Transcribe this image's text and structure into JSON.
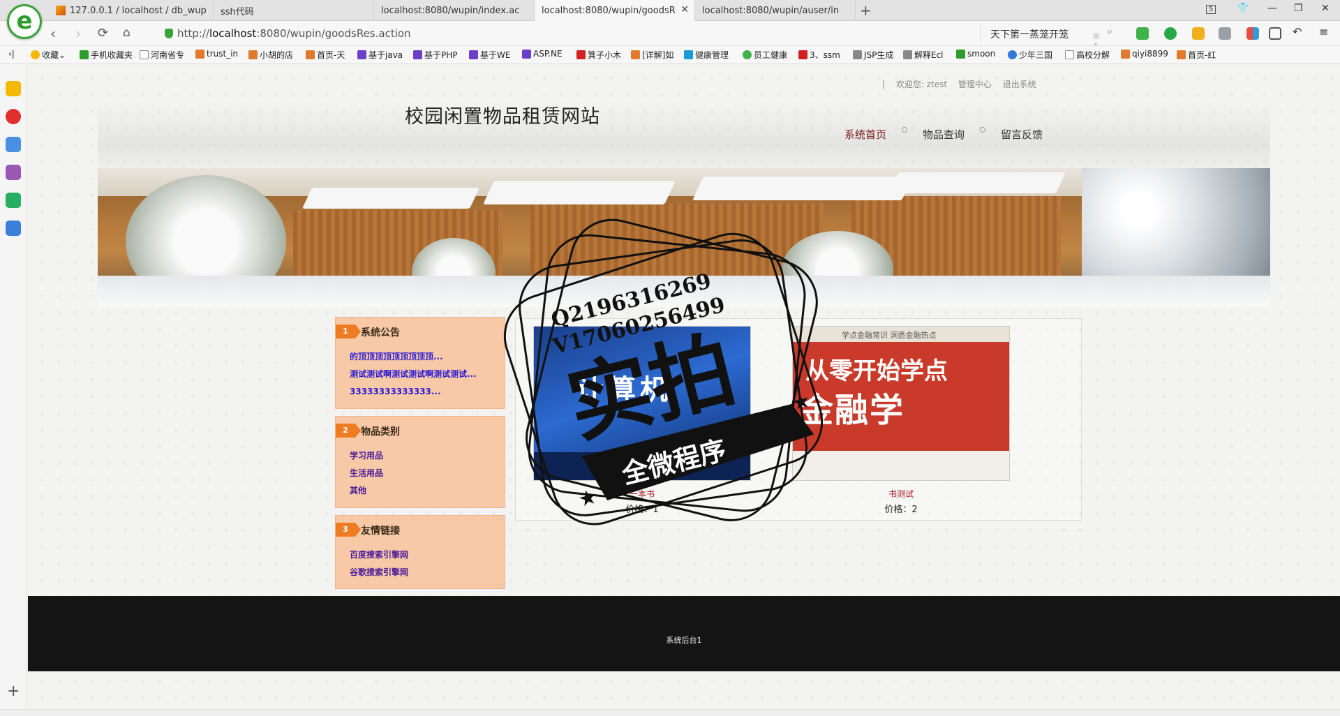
{
  "browser": {
    "tabs": [
      {
        "label": "127.0.0.1 / localhost / db_wup"
      },
      {
        "label": "ssh代码"
      },
      {
        "label": "localhost:8080/wupin/index.ac"
      },
      {
        "label": "localhost:8080/wupin/goodsR"
      },
      {
        "label": "localhost:8080/wupin/auser/in"
      }
    ],
    "tab_count": "5",
    "url_prefix": "http://",
    "url_host": "localhost",
    "url_rest": ":8080/wupin/goodsRes.action",
    "search_text": "天下第一蒸笼开笼",
    "bookmarks": [
      "收藏",
      "手机收藏夹",
      "河南省专",
      "trust_in",
      "小胡的店",
      "首页-天",
      "基于java",
      "基于PHP",
      "基于WE",
      "ASP.NE",
      "箕子小木",
      "[详解]如",
      "健康管理",
      "员工健康",
      "3、ssm",
      "JSP生成",
      "解释Ecl",
      "smoon",
      "少年三国",
      "高校分解",
      "qiyi8899",
      "首页-红"
    ]
  },
  "site": {
    "topbar": {
      "divider": "|",
      "welcome": "欢迎您: ztest",
      "admin": "管理中心",
      "logout": "退出系统"
    },
    "title": "校园闲置物品租赁网站",
    "nav": [
      {
        "label": "系统首页"
      },
      {
        "label": "物品查询"
      },
      {
        "label": "留言反馈"
      }
    ],
    "boxes": {
      "notice": {
        "num": "1",
        "title": "系统公告",
        "items": [
          "的顶顶顶顶顶顶顶顶顶...",
          "测试测试啊测试测试啊测试测试...",
          "33333333333333..."
        ]
      },
      "category": {
        "num": "2",
        "title": "物品类别",
        "items": [
          "学习用品",
          "生活用品",
          "其他"
        ]
      },
      "links": {
        "num": "3",
        "title": "友情链接",
        "items": [
          "百度搜索引擎网",
          "谷歌搜索引擎网"
        ]
      }
    },
    "goods": [
      {
        "name": "一本书",
        "price": "价格：1",
        "cover_text": "计算机"
      },
      {
        "name": "书测试",
        "price": "价格：2",
        "cover_header": "学点金融常识 洞悉金融热点",
        "cover_line1": "从零开始学点",
        "cover_line2": "金融学"
      }
    ],
    "footer": "系统后台1"
  },
  "watermark": {
    "line1": "Q2196316269",
    "line2": "V17060256499",
    "big": "实拍",
    "ribbon": "全微程序"
  },
  "colors": {
    "accent_orange": "#ef7b23",
    "box_bg": "#f8c9a6",
    "nav_current": "#7a1515",
    "link_blue": "#2a1ad6",
    "footer_bg": "#151515"
  }
}
